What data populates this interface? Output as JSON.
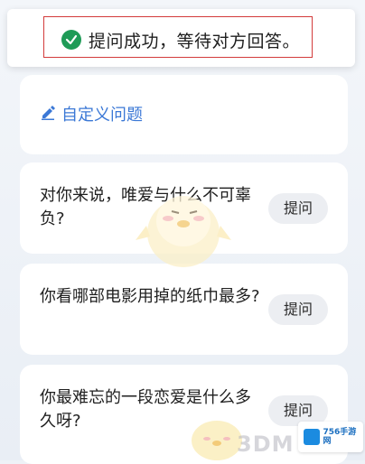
{
  "toast": {
    "message": "提问成功，等待对方回答。"
  },
  "custom_question": {
    "label": "自定义问题"
  },
  "questions": [
    {
      "text": "对你来说，唯爱与什么不可辜负?",
      "button": "提问"
    },
    {
      "text": "你看哪部电影用掉的纸巾最多?",
      "button": "提问"
    },
    {
      "text": "你最难忘的一段恋爱是什么多久呀?",
      "button": "提问"
    }
  ],
  "watermark": {
    "brand": "3DM",
    "site": "756手游网"
  },
  "colors": {
    "accent": "#3b78d6",
    "success": "#1f9b57",
    "highlight": "#d33b3b"
  }
}
